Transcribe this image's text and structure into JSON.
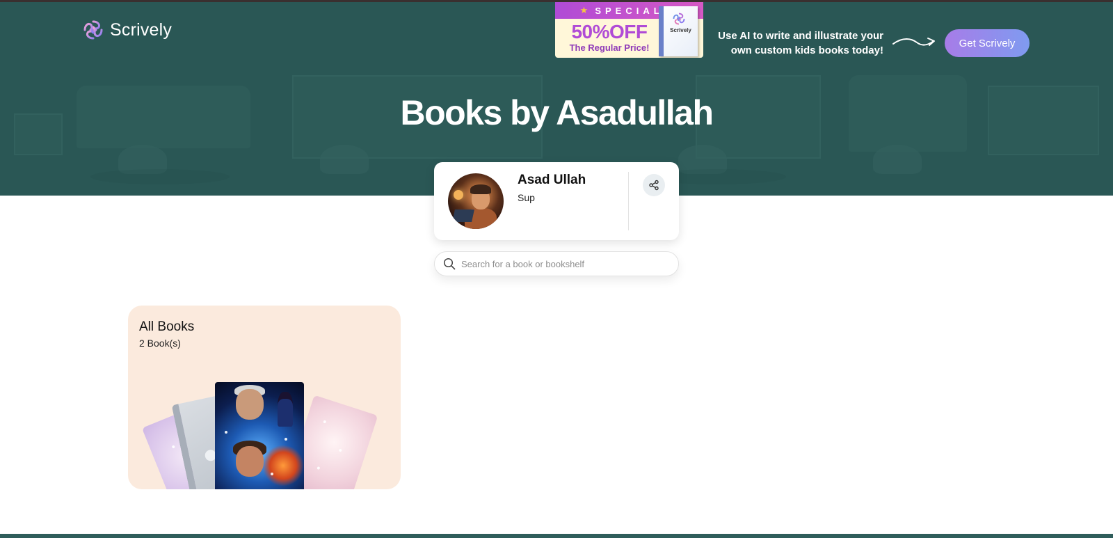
{
  "brand": {
    "name": "Scrively"
  },
  "promo": {
    "header": "SPECIAL",
    "headline": "50%OFF",
    "subline": "The Regular Price!",
    "box_label": "Scrively"
  },
  "header": {
    "tagline": "Use AI to write and illustrate your own custom kids books today!",
    "cta_label": "Get Scrively"
  },
  "page": {
    "title": "Books by Asadullah"
  },
  "profile": {
    "name": "Asad Ullah",
    "subtitle": "Sup"
  },
  "search": {
    "placeholder": "Search for a book or bookshelf",
    "value": ""
  },
  "bookshelves": [
    {
      "title": "All Books",
      "count": "2 Book(s)"
    }
  ],
  "colors": {
    "hero": "#2f5d5b",
    "cta_start": "#a77ce8",
    "cta_end": "#7f9bf0",
    "shelf_card": "#fbeadd"
  },
  "icons": [
    "scrively-logo-icon",
    "arrow-icon",
    "share-icon",
    "search-icon"
  ]
}
